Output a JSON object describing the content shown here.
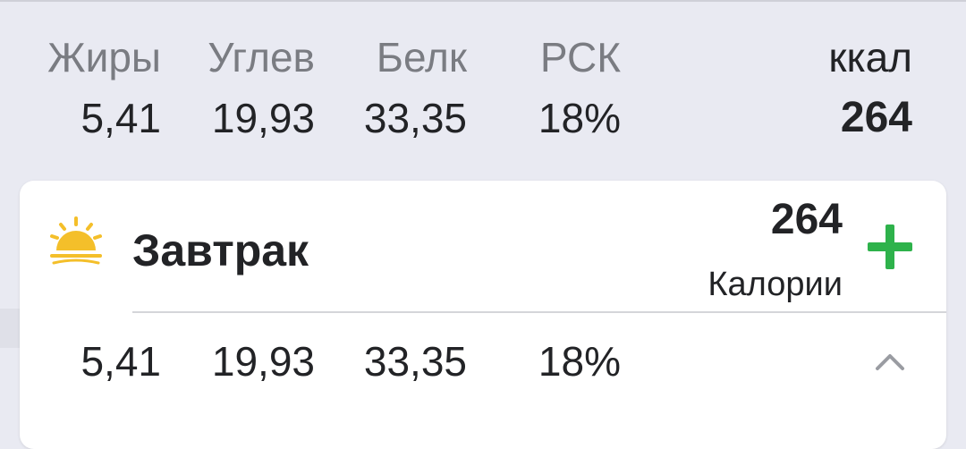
{
  "summary": {
    "headers": {
      "fat": "Жиры",
      "carbs": "Углев",
      "protein": "Белк",
      "rsk": "РСК",
      "kcal": "ккал"
    },
    "values": {
      "fat": "5,41",
      "carbs": "19,93",
      "protein": "33,35",
      "rsk": "18%",
      "kcal": "264"
    }
  },
  "meal": {
    "icon": "sunrise-icon",
    "title": "Завтрак",
    "calories": "264",
    "calories_label": "Калории",
    "add_icon": "plus-icon",
    "values": {
      "fat": "5,41",
      "carbs": "19,93",
      "protein": "33,35",
      "rsk": "18%"
    },
    "collapse_icon": "chevron-up-icon"
  },
  "colors": {
    "background": "#e9eaf2",
    "card": "#ffffff",
    "accent_green": "#2eb24b",
    "sun": "#f4bf2a",
    "text": "#222326",
    "muted_text": "#7a7c82"
  }
}
